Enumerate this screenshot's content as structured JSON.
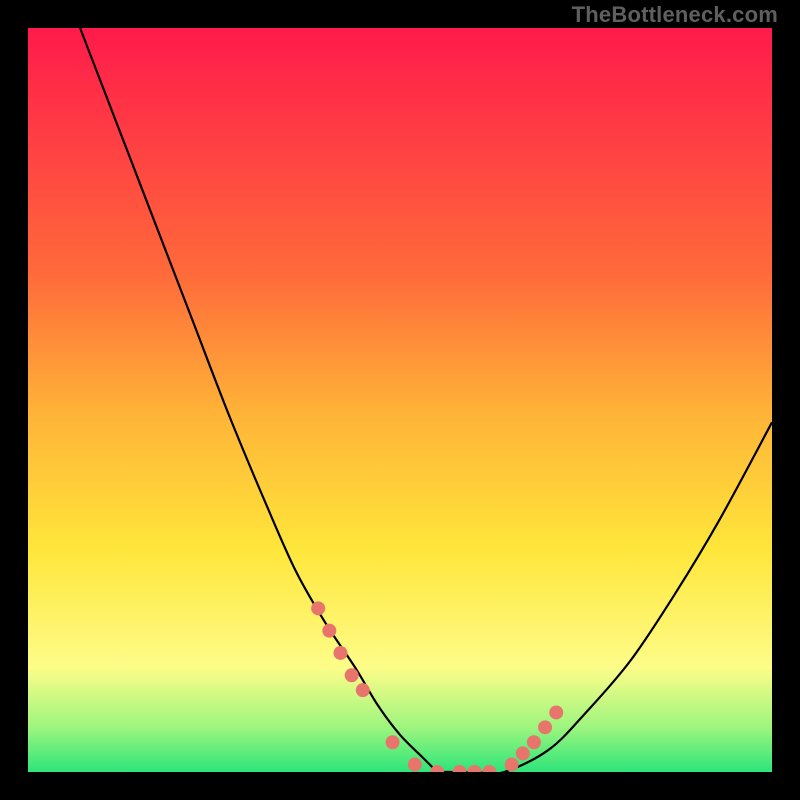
{
  "watermark": "TheBottleneck.com",
  "colors": {
    "background": "#000000",
    "watermark": "#5f5f5f",
    "curve": "#000000",
    "dot_fill": "#e8756c",
    "grad_top": "#ff1a4b",
    "grad_red_orange": "#ff6a3a",
    "grad_orange": "#ffb438",
    "grad_yellow": "#ffe63a",
    "grad_pale": "#fdfd89",
    "grad_green_light": "#9df57e",
    "grad_green": "#2de57a"
  },
  "chart_data": {
    "type": "area",
    "title": "",
    "xlabel": "",
    "ylabel": "",
    "xlim": [
      0,
      100
    ],
    "ylim": [
      0,
      100
    ],
    "series": [
      {
        "name": "left-curve",
        "x": [
          7,
          12,
          17,
          22,
          27,
          32,
          36,
          40,
          44,
          47,
          50,
          53,
          55
        ],
        "y": [
          100,
          87,
          74,
          61,
          48,
          36,
          27,
          20,
          14,
          9,
          5,
          2,
          0
        ]
      },
      {
        "name": "right-curve",
        "x": [
          55,
          60,
          64,
          70,
          75,
          81,
          87,
          93,
          100
        ],
        "y": [
          0,
          0,
          0,
          3,
          8,
          15,
          24,
          34,
          47
        ]
      }
    ],
    "dots": {
      "name": "highlight-dots",
      "x": [
        39,
        40.5,
        42,
        43.5,
        45,
        49,
        52,
        55,
        58,
        60,
        62,
        65,
        66.5,
        68,
        69.5,
        71
      ],
      "y": [
        22,
        19,
        16,
        13,
        11,
        4,
        1,
        0,
        0,
        0,
        0,
        1,
        2.5,
        4,
        6,
        8
      ]
    },
    "gradient_stops": [
      {
        "pos": 0.0,
        "key": "grad_top"
      },
      {
        "pos": 0.33,
        "key": "grad_red_orange"
      },
      {
        "pos": 0.52,
        "key": "grad_orange"
      },
      {
        "pos": 0.7,
        "key": "grad_yellow"
      },
      {
        "pos": 0.86,
        "key": "grad_pale"
      },
      {
        "pos": 0.94,
        "key": "grad_green_light"
      },
      {
        "pos": 1.0,
        "key": "grad_green"
      }
    ]
  }
}
